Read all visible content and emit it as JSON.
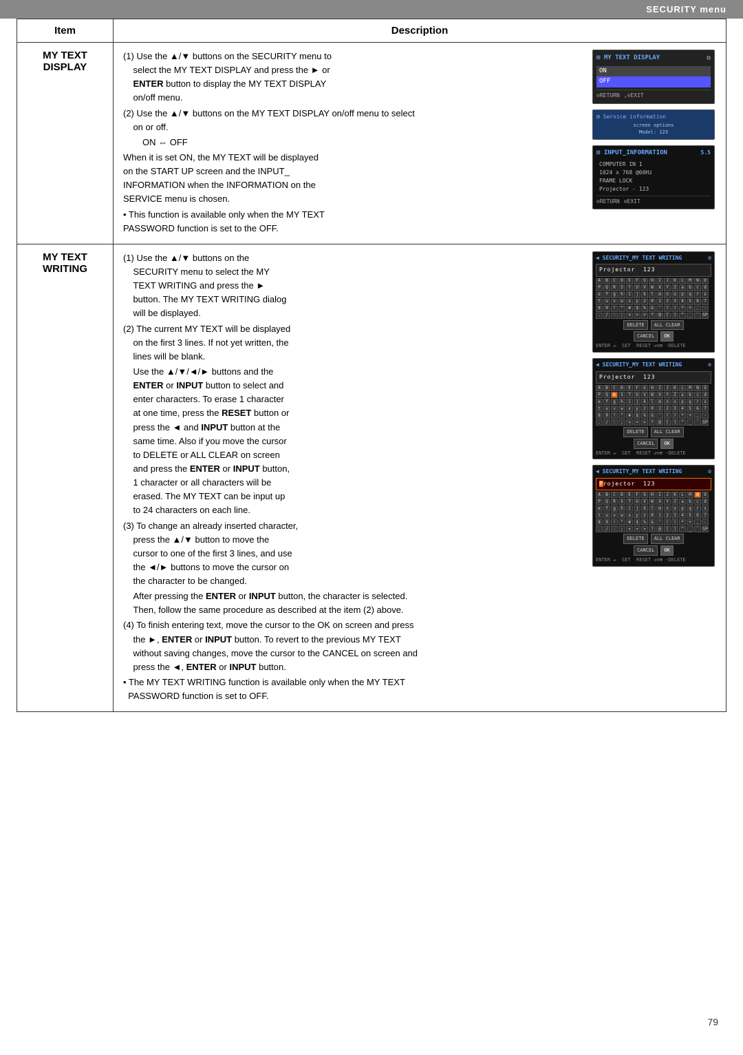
{
  "header": {
    "title": "SECURITY menu"
  },
  "table": {
    "col1": "Item",
    "col2": "Description"
  },
  "rows": [
    {
      "item": "MY TEXT\nDISPLAY",
      "desc_paragraphs": [
        "(1) Use the ▲/▼ buttons on the SECURITY menu to select the MY TEXT DISPLAY and press the ► or ENTER button to display the MY TEXT DISPLAY on/off menu.",
        "(2) Use the ▲/▼ buttons on the MY TEXT DISPLAY on/off menu to select on or off.",
        "ON ⇔ OFF",
        "When it is set ON, the MY TEXT will be displayed on the START UP screen and the INPUT_INFORMATION when the INFORMATION on the SERVICE menu is chosen.",
        "• This function is available only when the MY TEXT PASSWORD function is set to the OFF."
      ]
    },
    {
      "item": "MY TEXT\nWRITING",
      "desc_paragraphs": [
        "(1) Use the ▲/▼ buttons on the SECURITY menu to select the MY TEXT WRITING and press the ► button. The MY TEXT WRITING dialog will be displayed.",
        "(2) The current MY TEXT will be displayed on the first 3 lines. If not yet written, the lines will be blank.",
        "Use the ▲/▼/◄/► buttons and the ENTER or INPUT button to select and enter characters. To erase 1 character at one time, press the RESET button or press the ◄ and INPUT button at the same time. Also if you move the cursor to DELETE or ALL CLEAR on screen and press the ENTER or INPUT button, 1 character or all characters will be erased. The MY TEXT can be input up to 24 characters on each line.",
        "(3) To change an already inserted character, press the ▲/▼ button to move the cursor to one of the first 3 lines, and use the ◄/► buttons to move the cursor on the character to be changed.",
        "After pressing the ENTER or INPUT button, the character is selected. Then, follow the same procedure as described at the item (2) above.",
        "(4) To finish entering text, move the cursor to the OK on screen and press the ►, ENTER or INPUT button. To revert to the previous MY TEXT without saving changes, move the cursor to the CANCEL on screen and press the ◄, ENTER or INPUT button.",
        "• The MY TEXT WRITING function is available only when the MY TEXT PASSWORD function is set to OFF."
      ]
    }
  ],
  "page_number": "79",
  "screens": {
    "display_on_off": {
      "title": "MY TEXT DISPLAY",
      "items": [
        "ON",
        "OFF"
      ],
      "footer": [
        "RETURN",
        "EXIT"
      ]
    },
    "service_info": {
      "title": "Service information",
      "text": "Model: 123"
    },
    "input_info": {
      "title": "INPUT_INFORMATION",
      "lines": [
        "COMPUTER IN 1",
        "1024 x 768 @60Hz",
        "FRAME LOCK",
        "Projector - 123"
      ],
      "footer": [
        "RETURN",
        "EXIT"
      ]
    },
    "writing1": {
      "title": "SECURITY_MY TEXT WRITING",
      "input": "Projector  123"
    },
    "writing2": {
      "title": "SECURITY_MY TEXT WRITING",
      "input": "Projector  123"
    },
    "writing3": {
      "title": "SECURITY_MY TEXT WRITING",
      "input": "Projector  123"
    }
  }
}
